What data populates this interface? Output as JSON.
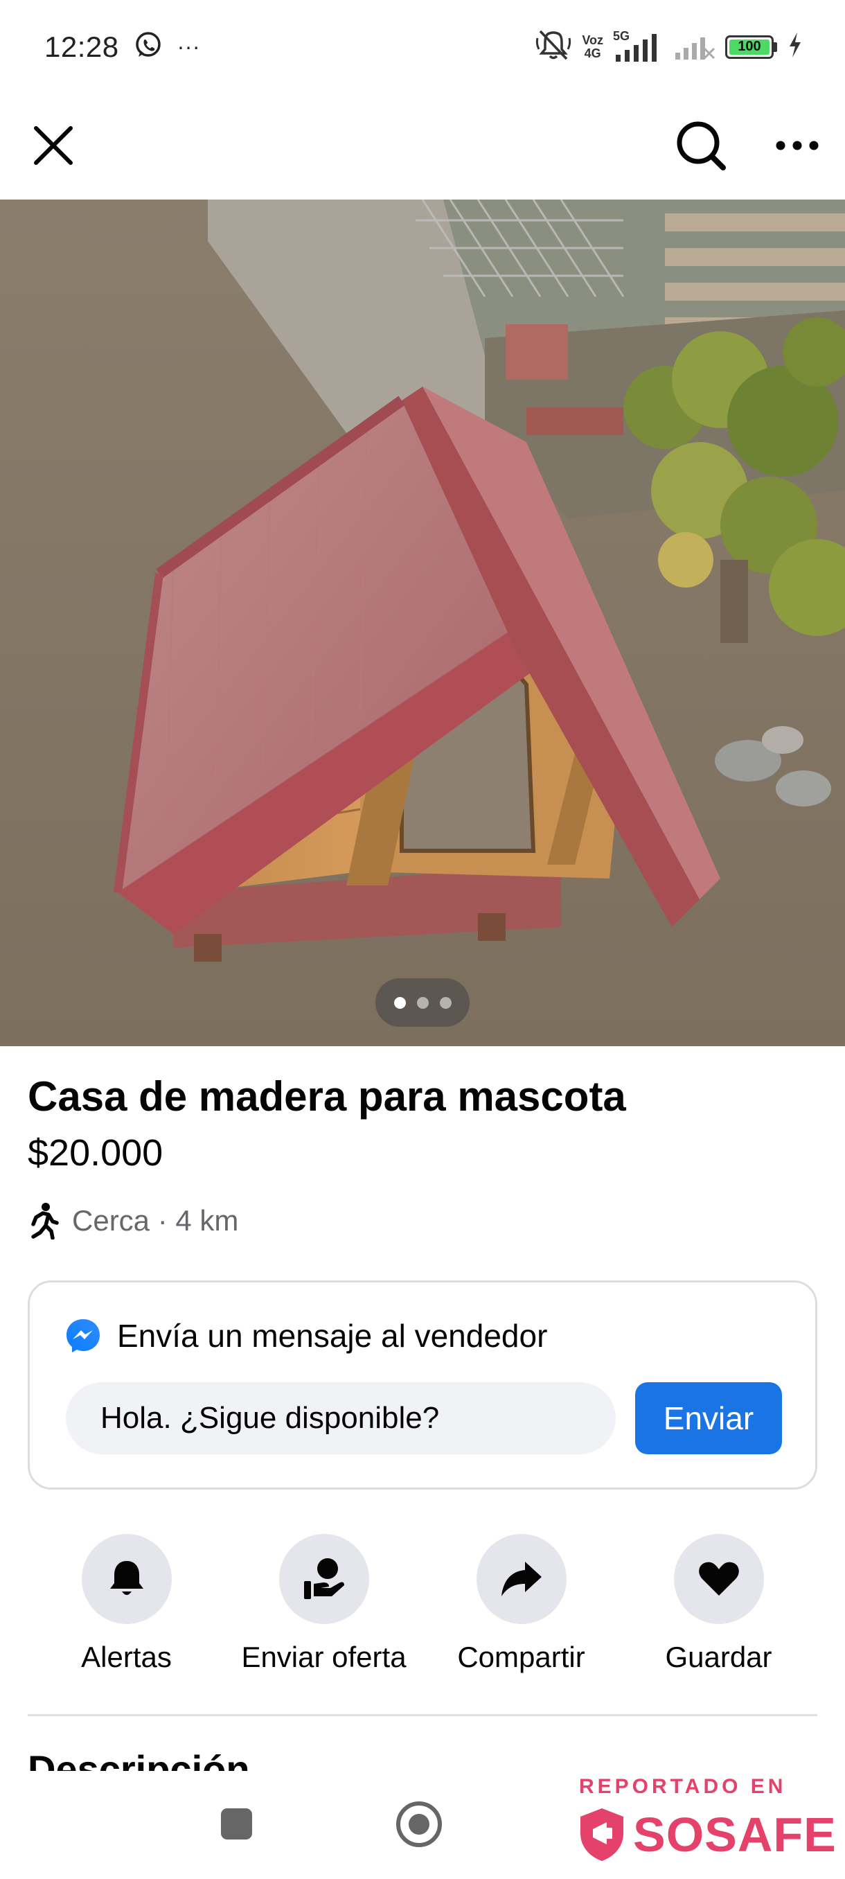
{
  "status_bar": {
    "time": "12:28",
    "overflow": "···",
    "net_voz": "Voz",
    "net_4g": "4G",
    "net_5g": "5G",
    "battery": "100",
    "icons": [
      "whatsapp-icon",
      "mute-icon",
      "signal-icon",
      "battery-icon",
      "charging-icon"
    ]
  },
  "nav": {
    "icons": [
      "close-icon",
      "search-icon",
      "more-icon"
    ]
  },
  "gallery": {
    "page_count": 3,
    "active_index": 0
  },
  "listing": {
    "title": "Casa de madera para mascota",
    "price": "$20.000",
    "distance": "Cerca · 4 km"
  },
  "message_card": {
    "heading": "Envía un mensaje al vendedor",
    "input_value": "Hola. ¿Sigue disponible?",
    "send_label": "Enviar"
  },
  "actions": [
    {
      "label": "Alertas",
      "icon": "bell-icon"
    },
    {
      "label": "Enviar oferta",
      "icon": "offer-icon"
    },
    {
      "label": "Compartir",
      "icon": "share-icon"
    },
    {
      "label": "Guardar",
      "icon": "heart-icon"
    }
  ],
  "description": {
    "heading": "Descripción"
  },
  "watermark": {
    "top": "REPORTADO EN",
    "brand": "SOSAFE"
  },
  "colors": {
    "accent": "#1b74e4",
    "watermark": "#e5426b",
    "secondary_text": "#65676b"
  }
}
